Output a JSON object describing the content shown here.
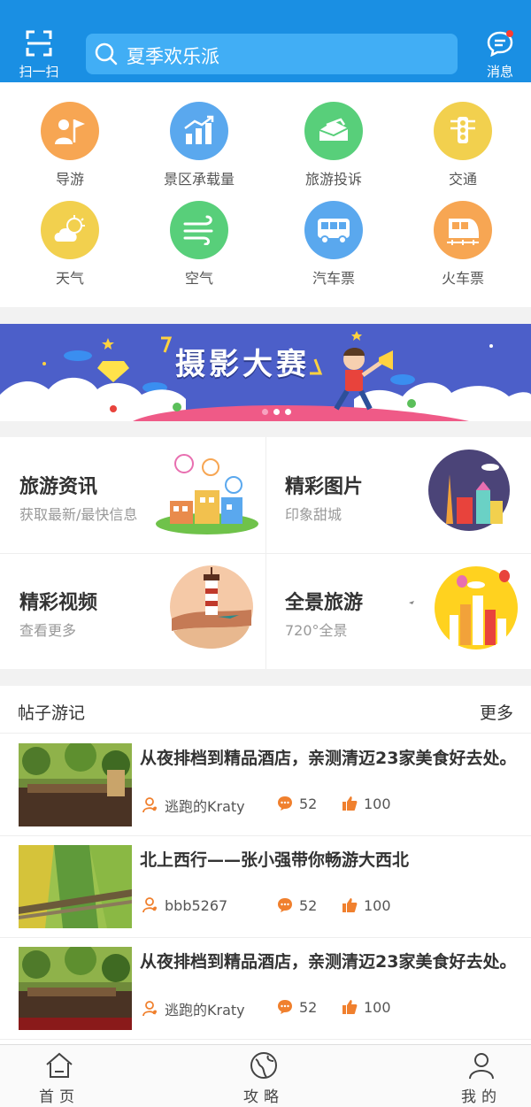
{
  "header": {
    "scan_label": "扫一扫",
    "search_placeholder": "夏季欢乐派",
    "message_label": "消息"
  },
  "services": [
    {
      "label": "导游",
      "icon": "guide-flag-icon",
      "color": "#f7a653"
    },
    {
      "label": "景区承载量",
      "icon": "bar-chart-icon",
      "color": "#5aa8ee"
    },
    {
      "label": "旅游投诉",
      "icon": "complaint-envelope-icon",
      "color": "#58cf7a"
    },
    {
      "label": "交通",
      "icon": "traffic-light-icon",
      "color": "#f2d04e"
    },
    {
      "label": "天气",
      "icon": "weather-icon",
      "color": "#f2d04e"
    },
    {
      "label": "空气",
      "icon": "wind-icon",
      "color": "#58cf7a"
    },
    {
      "label": "汽车票",
      "icon": "bus-icon",
      "color": "#5aa8ee"
    },
    {
      "label": "火车票",
      "icon": "train-icon",
      "color": "#f7a653"
    }
  ],
  "banner": {
    "title": "摄影大赛",
    "active_dot": 0,
    "dot_count": 3
  },
  "features": [
    {
      "title": "旅游资讯",
      "subtitle": "获取最新/最快信息"
    },
    {
      "title": "精彩图片",
      "subtitle": "印象甜城"
    },
    {
      "title": "精彩视频",
      "subtitle": "查看更多"
    },
    {
      "title": "全景旅游",
      "subtitle": "720°全景"
    }
  ],
  "posts_section": {
    "title": "帖子游记",
    "more": "更多"
  },
  "posts": [
    {
      "title": "从夜排档到精品酒店，亲测清迈23家美食好去处。",
      "author": "逃跑的Kraty",
      "comments": "52",
      "likes": "100"
    },
    {
      "title": "北上西行——张小强带你畅游大西北",
      "author": "bbb5267",
      "comments": "52",
      "likes": "100"
    },
    {
      "title": "从夜排档到精品酒店，亲测清迈23家美食好去处。",
      "author": "逃跑的Kraty",
      "comments": "52",
      "likes": "100"
    }
  ],
  "bottom_nav": [
    {
      "label": "首页"
    },
    {
      "label": "攻略"
    },
    {
      "label": "我的"
    }
  ],
  "colors": {
    "header": "#1a8fe3",
    "search": "#41aef5",
    "banner_bg": "#4c5fc9",
    "meta_orange": "#f0802e"
  }
}
